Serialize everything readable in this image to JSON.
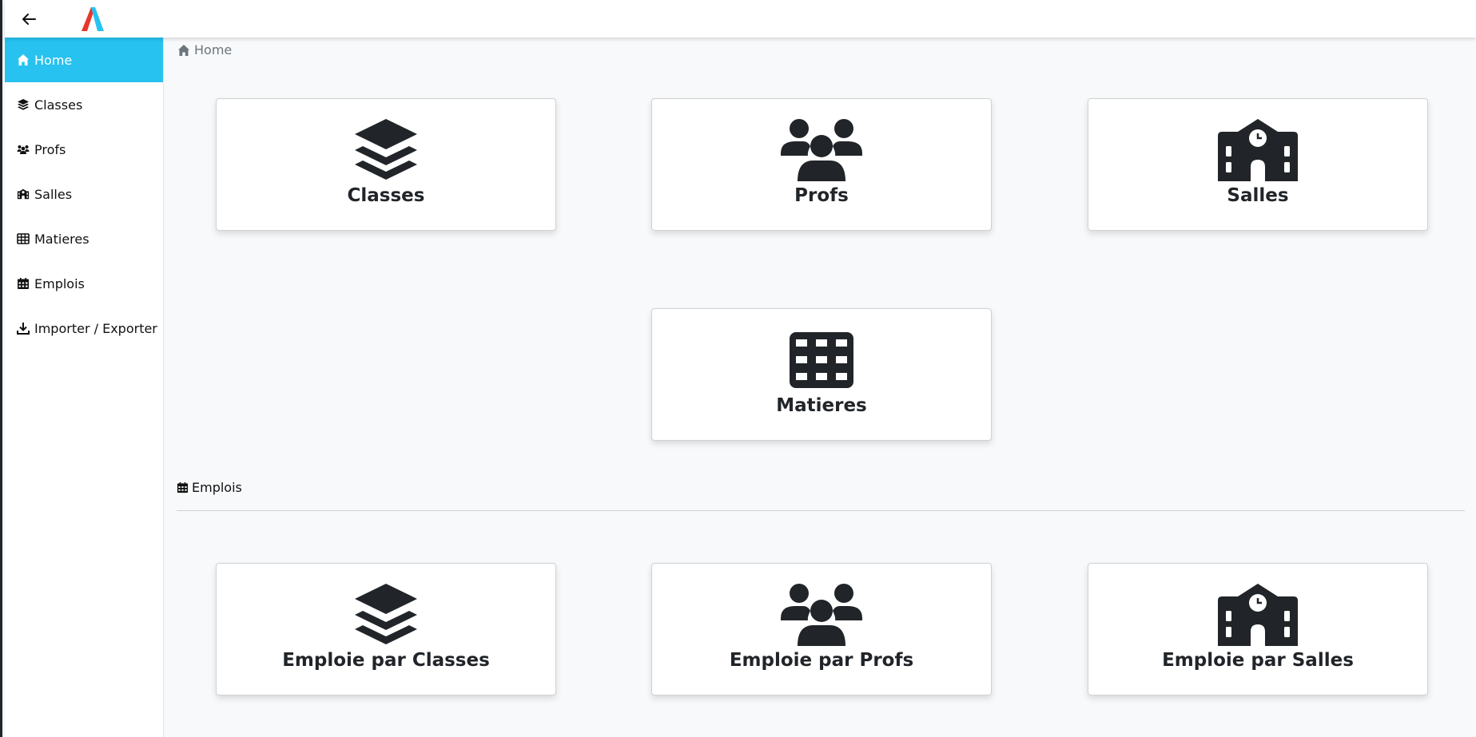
{
  "header": {
    "back_icon": "arrow-left-icon",
    "logo": "app-logo"
  },
  "sidebar": {
    "active_color": "#27c2f0",
    "items": [
      {
        "label": "Home",
        "icon": "home-icon",
        "active": true
      },
      {
        "label": "Classes",
        "icon": "layers-icon"
      },
      {
        "label": "Profs",
        "icon": "users-icon"
      },
      {
        "label": "Salles",
        "icon": "school-icon"
      },
      {
        "label": "Matieres",
        "icon": "table-icon"
      },
      {
        "label": "Emplois",
        "icon": "calendar-icon"
      },
      {
        "label": "Importer / Exporter",
        "icon": "download-icon"
      }
    ]
  },
  "breadcrumb": {
    "label": "Home",
    "icon": "home-icon"
  },
  "cards": [
    {
      "label": "Classes",
      "icon": "layers-icon"
    },
    {
      "label": "Profs",
      "icon": "users-icon"
    },
    {
      "label": "Salles",
      "icon": "school-icon"
    },
    {
      "label": "Matieres",
      "icon": "table-icon"
    }
  ],
  "emplois_section": {
    "title": "Emplois",
    "icon": "calendar-icon",
    "cards": [
      {
        "label": "Emploie par Classes",
        "icon": "layers-icon"
      },
      {
        "label": "Emploie par Profs",
        "icon": "users-icon"
      },
      {
        "label": "Emploie par Salles",
        "icon": "school-icon"
      }
    ]
  }
}
